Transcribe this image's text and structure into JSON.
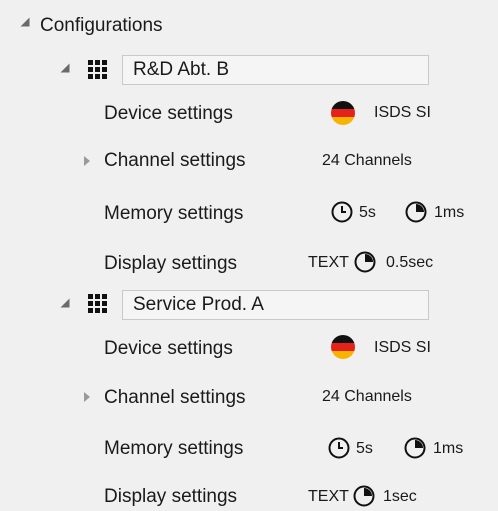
{
  "tree": {
    "root_label": "Configurations",
    "groups": [
      {
        "name": "R&D Abt. B",
        "rows": [
          {
            "label": "Device settings",
            "value": "ISDS SI",
            "icon": "germany-flag-icon"
          },
          {
            "label": "Channel settings",
            "value": "24 Channels"
          },
          {
            "label": "Memory settings",
            "value1": "5s",
            "value2": "1ms",
            "icon1": "clock-icon",
            "icon2": "pie-timer-icon"
          },
          {
            "label": "Display settings",
            "prefix": "TEXT",
            "value": "0.5sec",
            "icon": "pie-timer-icon"
          }
        ]
      },
      {
        "name": "Service Prod. A",
        "rows": [
          {
            "label": "Device settings",
            "value": "ISDS SI",
            "icon": "germany-flag-icon"
          },
          {
            "label": "Channel settings",
            "value": "24 Channels"
          },
          {
            "label": "Memory settings",
            "value1": "5s",
            "value2": "1ms",
            "icon1": "clock-icon",
            "icon2": "pie-timer-icon"
          },
          {
            "label": "Display settings",
            "prefix": "TEXT",
            "value": "1sec",
            "icon": "pie-timer-icon"
          }
        ]
      }
    ]
  },
  "colors": {
    "background": "#f0f0f0",
    "flag_black": "#111111",
    "flag_red": "#e5211b",
    "flag_gold": "#f6b400"
  }
}
